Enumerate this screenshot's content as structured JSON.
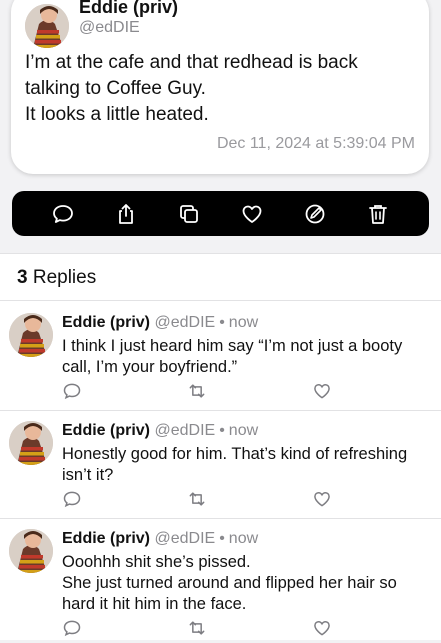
{
  "post": {
    "author_name": "Eddie (priv)",
    "author_handle": "@edDIE",
    "body_lines": [
      "I’m at the cafe and that redhead is back",
      "talking to Coffee Guy.",
      "It looks a little heated."
    ],
    "timestamp": "Dec 11, 2024 at 5:39:04 PM"
  },
  "actions": [
    {
      "icon": "reply-icon"
    },
    {
      "icon": "share-icon"
    },
    {
      "icon": "copy-icon"
    },
    {
      "icon": "like-icon"
    },
    {
      "icon": "edit-icon"
    },
    {
      "icon": "delete-icon"
    }
  ],
  "replies_header": {
    "count": "3",
    "label": "Replies"
  },
  "replies": [
    {
      "name": "Eddie (priv)",
      "handle": "@edDIE",
      "dot": "•",
      "time": "now",
      "lines": [
        "I think I just heard him say “I’m not just a booty",
        "call, I’m your boyfriend.”"
      ]
    },
    {
      "name": "Eddie (priv)",
      "handle": "@edDIE",
      "dot": "•",
      "time": "now",
      "lines": [
        "Honestly good for him. That’s kind of refreshing",
        "isn’t it?"
      ]
    },
    {
      "name": "Eddie (priv)",
      "handle": "@edDIE",
      "dot": "•",
      "time": "now",
      "lines": [
        "Ooohhh shit she’s pissed.",
        "She just turned around and flipped her hair so",
        "hard it hit him in the face."
      ]
    }
  ],
  "colors": {
    "background": "#f2f2f4",
    "action_bar": "#000000",
    "secondary_text": "#8a8a8e",
    "icon_gray": "#7d7d82"
  }
}
